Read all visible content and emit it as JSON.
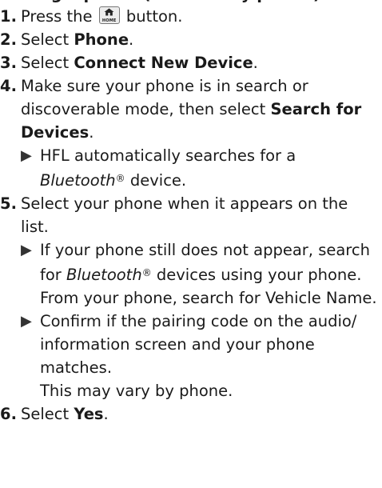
{
  "heading": "Pairing a phone (not already paired)",
  "home_icon": {
    "name": "home-icon",
    "text": "HOME"
  },
  "steps": [
    {
      "num": "1.",
      "before": "Press the ",
      "after": " button."
    },
    {
      "num": "2.",
      "before": "Select ",
      "bold": "Phone",
      "after": "."
    },
    {
      "num": "3.",
      "before": "Select ",
      "bold": "Connect New Device",
      "after": "."
    },
    {
      "num": "4.",
      "before": "Make sure your phone is in search or discoverable mode, then select ",
      "bold": "Search for Devices",
      "after": "."
    },
    {
      "num": "5.",
      "text": "Select your phone when it appears on the list."
    },
    {
      "num": "6.",
      "before": "Select ",
      "bold": "Yes",
      "after": "."
    }
  ],
  "notes": {
    "step4": {
      "before": "HFL automatically searches for a ",
      "italic": "Bluetooth",
      "reg": "®",
      "after": " device."
    },
    "step5a": {
      "before": "If your phone still does not appear, search for ",
      "italic": "Bluetooth",
      "reg": "®",
      "after": " devices using your phone.",
      "extra": "From your phone, search for Vehicle Name."
    },
    "step5b": {
      "text": "Confirm if the pairing code on the audio/ information screen and your phone matches.",
      "extra": "This may vary by phone."
    }
  },
  "colors": {
    "text": "#1a1a1a",
    "arrow": "#333333"
  }
}
